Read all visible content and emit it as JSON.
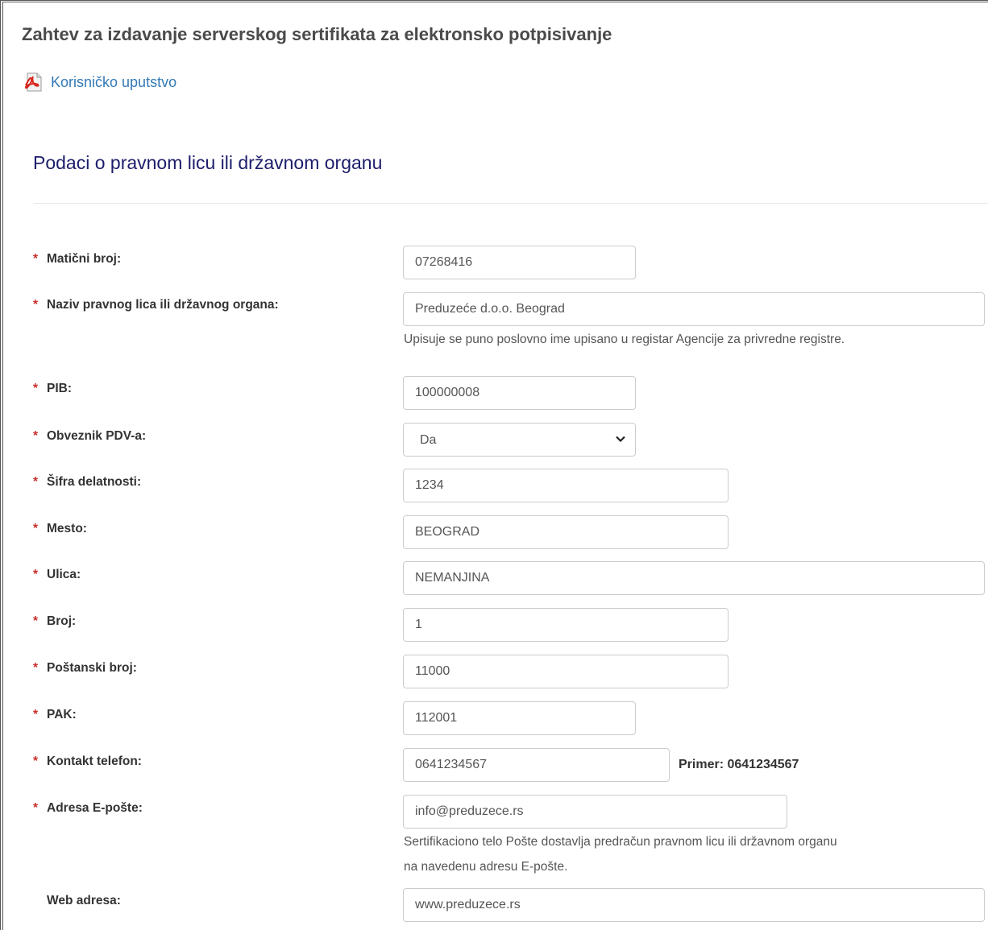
{
  "page": {
    "title": "Zahtev za izdavanje serverskog sertifikata za elektronsko potpisivanje",
    "manual_link": "Korisničko uputstvo",
    "manual_icon": "pdf-icon"
  },
  "section": {
    "title": "Podaci o pravnom licu ili državnom organu"
  },
  "colors": {
    "required_marker": "#c9302c",
    "link": "#337ab7",
    "section_title": "#1d1d6b"
  },
  "form": {
    "required_marker": "*",
    "maticni_broj": {
      "label": "Matični broj:",
      "value": "07268416"
    },
    "naziv": {
      "label": "Naziv pravnog lica ili državnog organa:",
      "value": "Preduzeće d.o.o. Beograd",
      "help": "Upisuje se puno poslovno ime upisano u registar Agencije za privredne registre."
    },
    "pib": {
      "label": "PIB:",
      "value": "100000008"
    },
    "obveznik_pdv": {
      "label": "Obveznik PDV-a:",
      "selected": "Da"
    },
    "sifra_delatnosti": {
      "label": "Šifra delatnosti:",
      "value": "1234"
    },
    "mesto": {
      "label": "Mesto:",
      "value": "BEOGRAD"
    },
    "ulica": {
      "label": "Ulica:",
      "value": "NEMANJINA"
    },
    "broj": {
      "label": "Broj:",
      "value": "1"
    },
    "postanski_broj": {
      "label": "Poštanski broj:",
      "value": "11000"
    },
    "pak": {
      "label": "PAK:",
      "value": "112001"
    },
    "kontakt_telefon": {
      "label": "Kontakt telefon:",
      "value": "0641234567",
      "example": "Primer: 0641234567"
    },
    "email": {
      "label": "Adresa E-pošte:",
      "value": "info@preduzece.rs",
      "help_line1": "Sertifikaciono telo Pošte dostavlja predračun pravnom licu ili državnom organu",
      "help_line2": "na navedenu adresu E-pošte."
    },
    "web_adresa": {
      "label": "Web adresa:",
      "value": "www.preduzece.rs"
    }
  }
}
